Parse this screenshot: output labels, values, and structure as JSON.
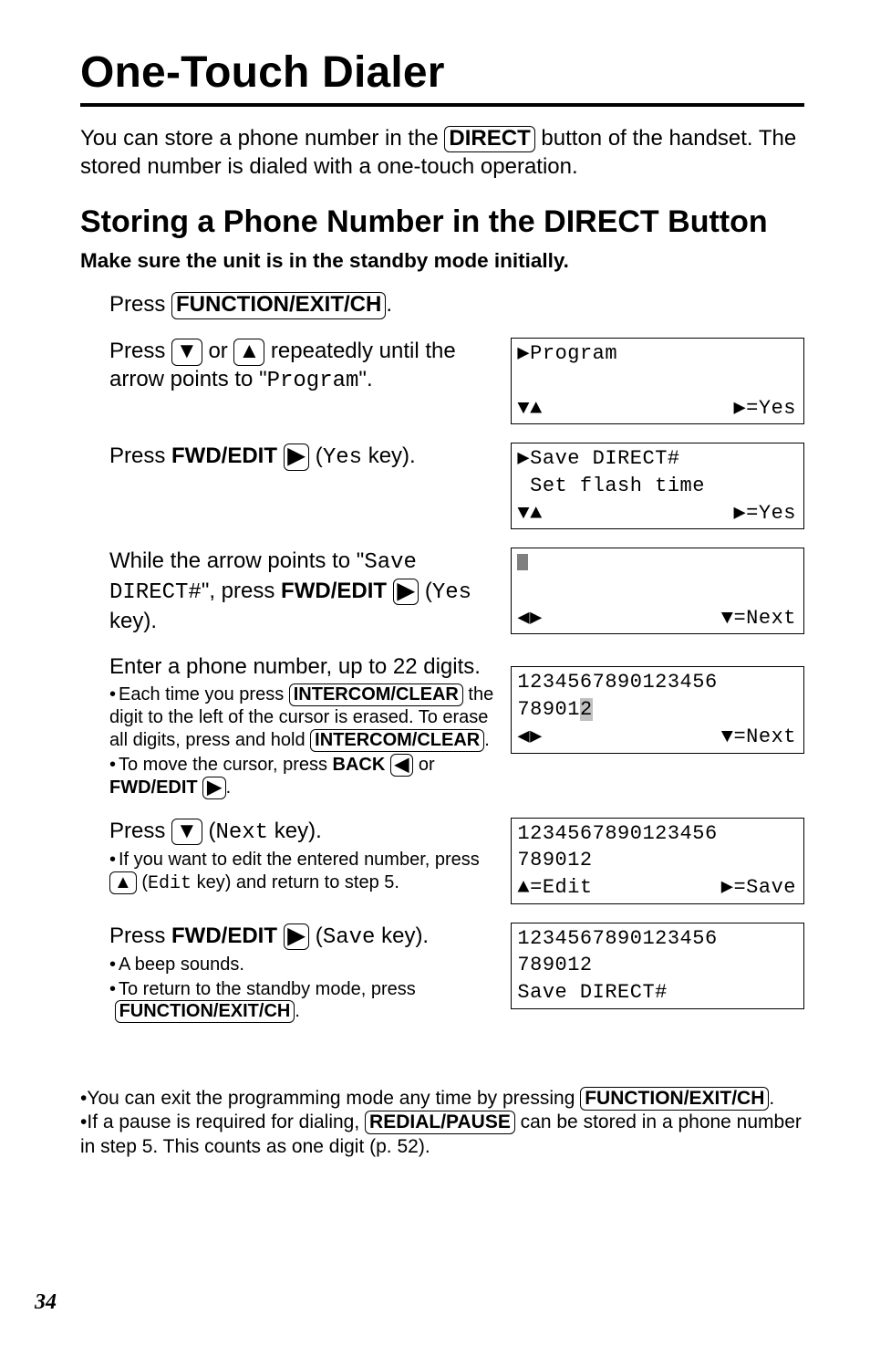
{
  "page_number": "34",
  "title": "One-Touch Dialer",
  "intro_a": "You can store a phone number in the ",
  "intro_b": " button of the handset. The stored number is dialed with a one-touch operation.",
  "btn_direct": "DIRECT",
  "h2": "Storing a Phone Number in the DIRECT Button",
  "bold_line": "Make sure the unit is in the standby mode initially.",
  "btn_func": "FUNCTION/EXIT/CH",
  "btn_intercom": "INTERCOM/CLEAR",
  "btn_redial": "REDIAL/PAUSE",
  "step1": {
    "a": "Press ",
    "b": "."
  },
  "step2": {
    "a": "Press ",
    "b": " or ",
    "c": " repeatedly until the arrow points to \"",
    "prog": "Program",
    "d": "\"."
  },
  "arrows": {
    "down": "▼",
    "up": "▲",
    "right": "▶",
    "left": "◀",
    "updown": "▼▲",
    "leftright": "◀▶"
  },
  "lcd1": {
    "l1": "▶Program",
    "l2a": "▼▲",
    "l2b": "▶=Yes"
  },
  "step3": {
    "a": "Press ",
    "label": "FWD/EDIT",
    "b": " (",
    "yes": "Yes",
    "c": " key)."
  },
  "lcd2": {
    "l1": "▶Save DIRECT#",
    "l2": " Set flash time",
    "l3a": "▼▲",
    "l3b": "▶=Yes"
  },
  "step4": {
    "a": "While the arrow points to \"",
    "save": "Save DIRECT#",
    "b": "\", press ",
    "label": "FWD/EDIT",
    "c": " (",
    "yes": "Yes",
    "d": " key)."
  },
  "lcd3": {
    "l2a": "◀▶",
    "l2b": "▼=Next"
  },
  "step5": {
    "main": "Enter a phone number, up to 22 digits.",
    "s1a": "Each time you press ",
    "s1b": " the digit to the left of the cursor is erased. To erase all digits, press and hold ",
    "s1c": ".",
    "s2a": "To move the cursor, press ",
    "s2back": "BACK",
    "s2b": " or ",
    "s2fwd": "FWD/EDIT",
    "s2c": "."
  },
  "lcd4": {
    "l1": "1234567890123456",
    "l2": "78901",
    "l2tail": "2",
    "l3a": "◀▶",
    "l3b": "▼=Next"
  },
  "step6": {
    "a": "Press ",
    "b": " (",
    "next": "Next",
    "c": " key).",
    "s1a": "If you want to edit the entered number, press ",
    "s1b": " (",
    "edit": "Edit",
    "s1c": " key) and return to step 5."
  },
  "lcd5": {
    "l1": "1234567890123456",
    "l2": "789012",
    "l3a": "▲=Edit",
    "l3b": "▶=Save"
  },
  "step7": {
    "a": "Press ",
    "label": "FWD/EDIT",
    "b": " (",
    "save": "Save",
    "c": " key).",
    "s1": "A beep sounds.",
    "s2a": "To return to the standby mode, press ",
    "s2b": "."
  },
  "lcd6": {
    "l1": "1234567890123456",
    "l2": "789012",
    "l3": "Save DIRECT#"
  },
  "notes": {
    "n1a": "You can exit the programming mode any time by pressing ",
    "n1b": ".",
    "n2a": "If a pause is required for dialing, ",
    "n2b": " can be stored in a phone number in step 5. This counts as one digit (p. 52)."
  }
}
